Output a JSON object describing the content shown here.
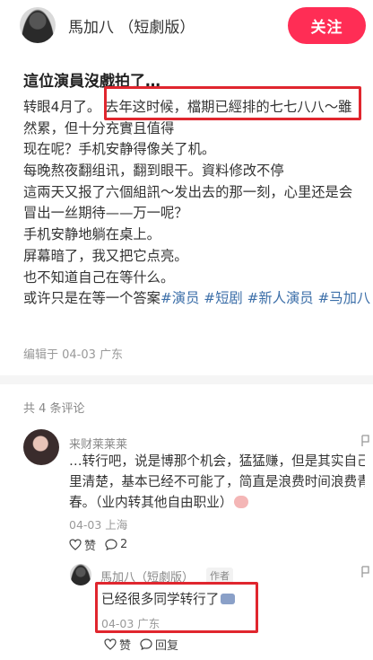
{
  "header": {
    "author": "馬加八 （短劇版）",
    "follow_label": "关注"
  },
  "post": {
    "title": "這位演員沒戲拍了…",
    "lines": [
      "转眼4月了。 去年这时候，檔期已經排的七七八八～雖",
      "然累，但十分充實且值得",
      "现在呢？手机安静得像关了机。",
      "每晚熬夜翻组讯，翻到眼干。資料修改不停",
      "這兩天又报了六個組訊～发出去的那一刻，心里还是会",
      "冒出一丝期待——万一呢？",
      "手机安静地躺在桌上。",
      "屏幕暗了，我又把它点亮。",
      "也不知道自己在等什么。"
    ],
    "last_line_text": "或许只是在等一个答案",
    "tags": [
      "#演员",
      "#短剧",
      "#新人演员",
      "#马加八"
    ],
    "edit_meta": "编辑于 04-03 广东"
  },
  "comments": {
    "count_label": "共 4 条评论",
    "first": {
      "author": "来财莱莱莱",
      "lines": [
        "…转行吧，说是博那个机会，猛猛赚，但是其实自己心",
        "里清楚，基本已经不可能了，简直是浪费时间浪费青",
        "春。（业内转其他自由职业）"
      ],
      "meta": "04-03 上海",
      "like_label": "赞",
      "reply_count": "2"
    },
    "reply": {
      "author": "馬加八（短劇版）",
      "badge": "作者",
      "text": "已经很多同学转行了",
      "meta": "04-03 广东",
      "like_label": "赞",
      "reply_label": "回复"
    }
  },
  "colors": {
    "accent": "#ff2d55",
    "tag": "#3b6ea8",
    "highlight_box": "#e0262e"
  }
}
